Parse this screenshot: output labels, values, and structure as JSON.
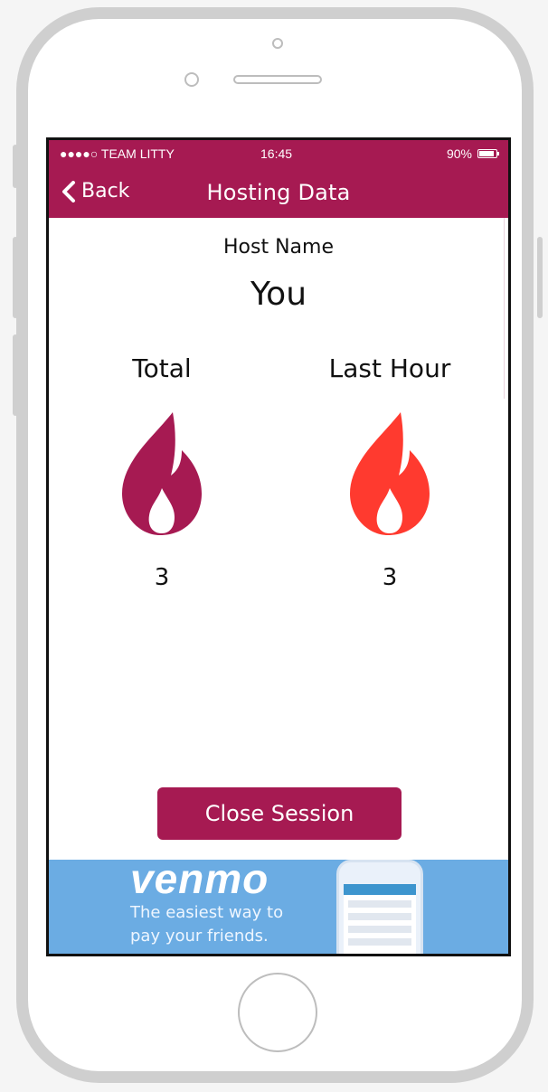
{
  "status_bar": {
    "carrier": "●●●●○ TEAM LITTY",
    "time": "16:45",
    "battery": "90%"
  },
  "nav": {
    "back_label": "Back",
    "title": "Hosting Data"
  },
  "host": {
    "label": "Host Name",
    "name": "You"
  },
  "stats": {
    "total": {
      "label": "Total",
      "value": "3",
      "color": "#a61a52",
      "icon": "flame-icon"
    },
    "last_hour": {
      "label": "Last Hour",
      "value": "3",
      "color": "#ff3a2f",
      "icon": "flame-icon"
    }
  },
  "actions": {
    "close_label": "Close Session"
  },
  "ad": {
    "brand": "venmo",
    "line1": "The easiest way to",
    "line2": "pay your friends."
  },
  "colors": {
    "accent": "#a61a52",
    "hot": "#ff3a2f",
    "ad_bg": "#6bace3"
  }
}
